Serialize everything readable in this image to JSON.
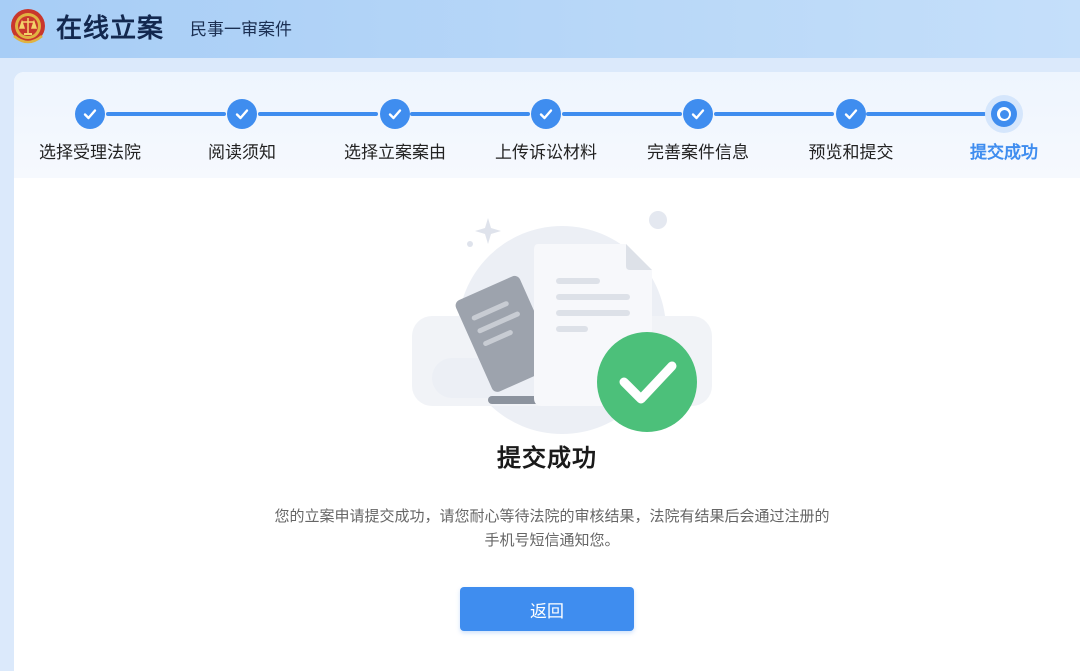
{
  "header": {
    "title": "在线立案",
    "subtitle": "民事一审案件",
    "emblem_icon": "court-emblem-icon"
  },
  "colors": {
    "accent": "#3f8def",
    "success": "#4cc07a",
    "header_bg": "#a9cdf5"
  },
  "steps": [
    {
      "label": "选择受理法院",
      "status": "done"
    },
    {
      "label": "阅读须知",
      "status": "done"
    },
    {
      "label": "选择立案案由",
      "status": "done"
    },
    {
      "label": "上传诉讼材料",
      "status": "done"
    },
    {
      "label": "完善案件信息",
      "status": "done"
    },
    {
      "label": "预览和提交",
      "status": "done"
    },
    {
      "label": "提交成功",
      "status": "current"
    }
  ],
  "result": {
    "icon": "success-check-icon",
    "title": "提交成功",
    "description": "您的立案申请提交成功，请您耐心等待法院的审核结果，法院有结果后会通过注册的手机号短信通知您。"
  },
  "actions": {
    "back_label": "返回"
  }
}
